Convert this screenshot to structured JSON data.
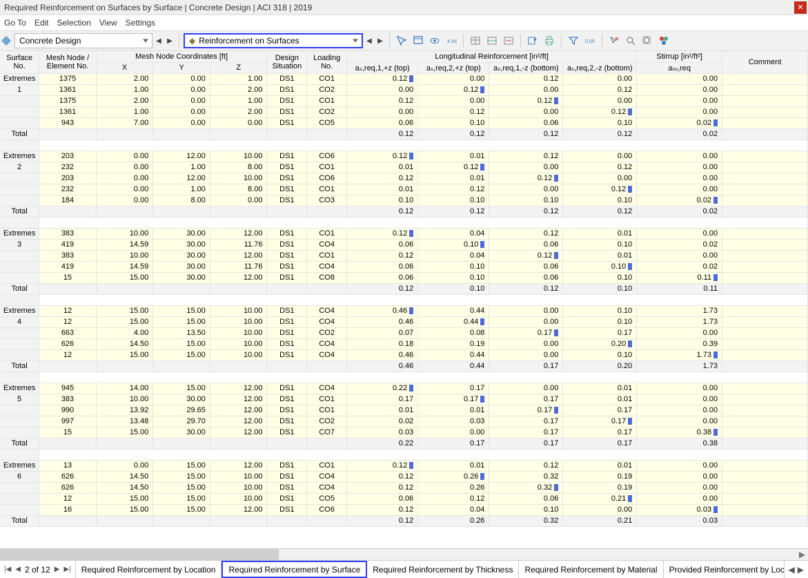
{
  "window": {
    "title": "Required Reinforcement on Surfaces by Surface | Concrete Design | ACI 318 | 2019"
  },
  "menu": {
    "items": [
      "Go To",
      "Edit",
      "Selection",
      "View",
      "Settings"
    ]
  },
  "toolbar": {
    "main_dropdown": "Concrete Design",
    "sub_dropdown": "Reinforcement on Surfaces"
  },
  "headers": {
    "h_surface": "Surface\nNo.",
    "h_node": "Mesh Node /\nElement No.",
    "h_coords": "Mesh Node Coordinates [ft]",
    "h_x": "X",
    "h_y": "Y",
    "h_z": "Z",
    "h_design": "Design\nSituation",
    "h_loading": "Loading\nNo.",
    "h_long": "Longitudinal Reinforcement [in²/ft]",
    "h_a1": "aₛ,req,1,+z (top)",
    "h_a2": "aₛ,req,2,+z (top)",
    "h_a3": "aₛ,req,1,-z (bottom)",
    "h_a4": "aₛ,req,2,-z (bottom)",
    "h_stirrup": "Stirrup [in²/ft²]",
    "h_asw": "aₛᵥ,req",
    "h_comment": "Comment"
  },
  "labels": {
    "extremes": "Extremes",
    "total": "Total"
  },
  "groups": [
    {
      "surf": "1",
      "rows": [
        {
          "n": "1375",
          "x": "2.00",
          "y": "0.00",
          "z": "1.00",
          "ds": "DS1",
          "lo": "CO1",
          "a1": "0.12",
          "m1": "b",
          "a2": "0.00",
          "a3": "0.12",
          "a4": "0.00",
          "asw": "0.00"
        },
        {
          "n": "1361",
          "x": "1.00",
          "y": "0.00",
          "z": "2.00",
          "ds": "DS1",
          "lo": "CO2",
          "a1": "0.00",
          "a2": "0.12",
          "m2": "b",
          "a3": "0.00",
          "a4": "0.12",
          "asw": "0.00"
        },
        {
          "n": "1375",
          "x": "2.00",
          "y": "0.00",
          "z": "1.00",
          "ds": "DS1",
          "lo": "CO1",
          "a1": "0.12",
          "a2": "0.00",
          "a3": "0.12",
          "m3": "b",
          "a4": "0.00",
          "asw": "0.00"
        },
        {
          "n": "1361",
          "x": "1.00",
          "y": "0.00",
          "z": "2.00",
          "ds": "DS1",
          "lo": "CO2",
          "a1": "0.00",
          "a2": "0.12",
          "a3": "0.00",
          "a4": "0.12",
          "m4": "b",
          "asw": "0.00"
        },
        {
          "n": "943",
          "x": "7.00",
          "y": "0.00",
          "z": "0.00",
          "ds": "DS1",
          "lo": "CO5",
          "a1": "0.06",
          "a2": "0.10",
          "a3": "0.06",
          "a4": "0.10",
          "asw": "0.02",
          "m5": "b"
        }
      ],
      "total": {
        "a1": "0.12",
        "a2": "0.12",
        "a3": "0.12",
        "a4": "0.12",
        "asw": "0.02"
      }
    },
    {
      "surf": "2",
      "rows": [
        {
          "n": "203",
          "x": "0.00",
          "y": "12.00",
          "z": "10.00",
          "ds": "DS1",
          "lo": "CO6",
          "a1": "0.12",
          "m1": "b",
          "a2": "0.01",
          "a3": "0.12",
          "a4": "0.00",
          "asw": "0.00"
        },
        {
          "n": "232",
          "x": "0.00",
          "y": "1.00",
          "z": "8.00",
          "ds": "DS1",
          "lo": "CO1",
          "a1": "0.01",
          "a2": "0.12",
          "m2": "b",
          "a3": "0.00",
          "a4": "0.12",
          "asw": "0.00"
        },
        {
          "n": "203",
          "x": "0.00",
          "y": "12.00",
          "z": "10.00",
          "ds": "DS1",
          "lo": "CO6",
          "a1": "0.12",
          "a2": "0.01",
          "a3": "0.12",
          "m3": "b",
          "a4": "0.00",
          "asw": "0.00"
        },
        {
          "n": "232",
          "x": "0.00",
          "y": "1.00",
          "z": "8.00",
          "ds": "DS1",
          "lo": "CO1",
          "a1": "0.01",
          "a2": "0.12",
          "a3": "0.00",
          "a4": "0.12",
          "m4": "b",
          "asw": "0.00"
        },
        {
          "n": "184",
          "x": "0.00",
          "y": "8.00",
          "z": "0.00",
          "ds": "DS1",
          "lo": "CO3",
          "a1": "0.10",
          "a2": "0.10",
          "a3": "0.10",
          "a4": "0.10",
          "asw": "0.02",
          "m5": "b"
        }
      ],
      "total": {
        "a1": "0.12",
        "a2": "0.12",
        "a3": "0.12",
        "a4": "0.12",
        "asw": "0.02"
      }
    },
    {
      "surf": "3",
      "rows": [
        {
          "n": "383",
          "x": "10.00",
          "y": "30.00",
          "z": "12.00",
          "ds": "DS1",
          "lo": "CO1",
          "a1": "0.12",
          "m1": "b",
          "a2": "0.04",
          "a3": "0.12",
          "a4": "0.01",
          "asw": "0.00"
        },
        {
          "n": "419",
          "x": "14.59",
          "y": "30.00",
          "z": "11.76",
          "ds": "DS1",
          "lo": "CO4",
          "a1": "0.06",
          "a2": "0.10",
          "m2": "b",
          "a3": "0.06",
          "a4": "0.10",
          "asw": "0.02"
        },
        {
          "n": "383",
          "x": "10.00",
          "y": "30.00",
          "z": "12.00",
          "ds": "DS1",
          "lo": "CO1",
          "a1": "0.12",
          "a2": "0.04",
          "a3": "0.12",
          "m3": "b",
          "a4": "0.01",
          "asw": "0.00"
        },
        {
          "n": "419",
          "x": "14.59",
          "y": "30.00",
          "z": "11.76",
          "ds": "DS1",
          "lo": "CO4",
          "a1": "0.06",
          "a2": "0.10",
          "a3": "0.06",
          "a4": "0.10",
          "m4": "b",
          "asw": "0.02"
        },
        {
          "n": "15",
          "x": "15.00",
          "y": "30.00",
          "z": "12.00",
          "ds": "DS1",
          "lo": "CO8",
          "a1": "0.06",
          "a2": "0.10",
          "a3": "0.06",
          "a4": "0.10",
          "asw": "0.11",
          "m5": "b"
        }
      ],
      "total": {
        "a1": "0.12",
        "a2": "0.10",
        "a3": "0.12",
        "a4": "0.10",
        "asw": "0.11"
      }
    },
    {
      "surf": "4",
      "rows": [
        {
          "n": "12",
          "x": "15.00",
          "y": "15.00",
          "z": "10.00",
          "ds": "DS1",
          "lo": "CO4",
          "a1": "0.46",
          "m1": "b",
          "a2": "0.44",
          "a3": "0.00",
          "a4": "0.10",
          "asw": "1.73"
        },
        {
          "n": "12",
          "x": "15.00",
          "y": "15.00",
          "z": "10.00",
          "ds": "DS1",
          "lo": "CO4",
          "a1": "0.46",
          "a2": "0.44",
          "m2": "b",
          "a3": "0.00",
          "a4": "0.10",
          "asw": "1.73"
        },
        {
          "n": "663",
          "x": "4.00",
          "y": "13.50",
          "z": "10.00",
          "ds": "DS1",
          "lo": "CO2",
          "a1": "0.07",
          "a2": "0.08",
          "a3": "0.17",
          "m3": "b",
          "a4": "0.17",
          "asw": "0.00"
        },
        {
          "n": "626",
          "x": "14.50",
          "y": "15.00",
          "z": "10.00",
          "ds": "DS1",
          "lo": "CO4",
          "a1": "0.18",
          "a2": "0.19",
          "a3": "0.00",
          "a4": "0.20",
          "m4": "b",
          "asw": "0.39"
        },
        {
          "n": "12",
          "x": "15.00",
          "y": "15.00",
          "z": "10.00",
          "ds": "DS1",
          "lo": "CO4",
          "a1": "0.46",
          "a2": "0.44",
          "a3": "0.00",
          "a4": "0.10",
          "asw": "1.73",
          "m5": "b"
        }
      ],
      "total": {
        "a1": "0.46",
        "a2": "0.44",
        "a3": "0.17",
        "a4": "0.20",
        "asw": "1.73"
      }
    },
    {
      "surf": "5",
      "rows": [
        {
          "n": "945",
          "x": "14.00",
          "y": "15.00",
          "z": "12.00",
          "ds": "DS1",
          "lo": "CO4",
          "a1": "0.22",
          "m1": "b",
          "a2": "0.17",
          "a3": "0.00",
          "a4": "0.01",
          "asw": "0.00"
        },
        {
          "n": "383",
          "x": "10.00",
          "y": "30.00",
          "z": "12.00",
          "ds": "DS1",
          "lo": "CO1",
          "a1": "0.17",
          "a2": "0.17",
          "m2": "b",
          "a3": "0.17",
          "a4": "0.01",
          "asw": "0.00"
        },
        {
          "n": "990",
          "x": "13.92",
          "y": "29.65",
          "z": "12.00",
          "ds": "DS1",
          "lo": "CO1",
          "a1": "0.01",
          "a2": "0.01",
          "a3": "0.17",
          "m3": "b",
          "a4": "0.17",
          "asw": "0.00"
        },
        {
          "n": "997",
          "x": "13.48",
          "y": "29.70",
          "z": "12.00",
          "ds": "DS1",
          "lo": "CO2",
          "a1": "0.02",
          "a2": "0.03",
          "a3": "0.17",
          "a4": "0.17",
          "m4": "b",
          "asw": "0.00"
        },
        {
          "n": "15",
          "x": "15.00",
          "y": "30.00",
          "z": "12.00",
          "ds": "DS1",
          "lo": "CO7",
          "a1": "0.03",
          "a2": "0.00",
          "a3": "0.17",
          "a4": "0.17",
          "asw": "0.38",
          "m5": "b"
        }
      ],
      "total": {
        "a1": "0.22",
        "a2": "0.17",
        "a3": "0.17",
        "a4": "0.17",
        "asw": "0.38"
      }
    },
    {
      "surf": "6",
      "rows": [
        {
          "n": "13",
          "x": "0.00",
          "y": "15.00",
          "z": "12.00",
          "ds": "DS1",
          "lo": "CO1",
          "a1": "0.12",
          "m1": "b",
          "a2": "0.01",
          "a3": "0.12",
          "a4": "0.01",
          "asw": "0.00"
        },
        {
          "n": "626",
          "x": "14.50",
          "y": "15.00",
          "z": "10.00",
          "ds": "DS1",
          "lo": "CO4",
          "a1": "0.12",
          "a2": "0.26",
          "m2": "b",
          "a3": "0.32",
          "a4": "0.19",
          "asw": "0.00"
        },
        {
          "n": "626",
          "x": "14.50",
          "y": "15.00",
          "z": "10.00",
          "ds": "DS1",
          "lo": "CO4",
          "a1": "0.12",
          "a2": "0.26",
          "a3": "0.32",
          "m3": "b",
          "a4": "0.19",
          "asw": "0.00"
        },
        {
          "n": "12",
          "x": "15.00",
          "y": "15.00",
          "z": "10.00",
          "ds": "DS1",
          "lo": "CO5",
          "a1": "0.06",
          "a2": "0.12",
          "a3": "0.06",
          "a4": "0.21",
          "m4": "b",
          "asw": "0.00"
        },
        {
          "n": "16",
          "x": "15.00",
          "y": "15.00",
          "z": "12.00",
          "ds": "DS1",
          "lo": "CO6",
          "a1": "0.12",
          "a2": "0.04",
          "a3": "0.10",
          "a4": "0.00",
          "asw": "0.03",
          "m5": "b"
        }
      ],
      "total": {
        "a1": "0.12",
        "a2": "0.26",
        "a3": "0.32",
        "a4": "0.21",
        "asw": "0.03"
      }
    }
  ],
  "footer": {
    "page": "2 of 12",
    "tabs": [
      {
        "label": "Required Reinforcement by Location",
        "active": false
      },
      {
        "label": "Required Reinforcement by Surface",
        "active": true
      },
      {
        "label": "Required Reinforcement by Thickness",
        "active": false
      },
      {
        "label": "Required Reinforcement by Material",
        "active": false
      },
      {
        "label": "Provided Reinforcement by Location",
        "active": false
      },
      {
        "label": "Provided Reinforcement by",
        "active": false
      }
    ]
  }
}
